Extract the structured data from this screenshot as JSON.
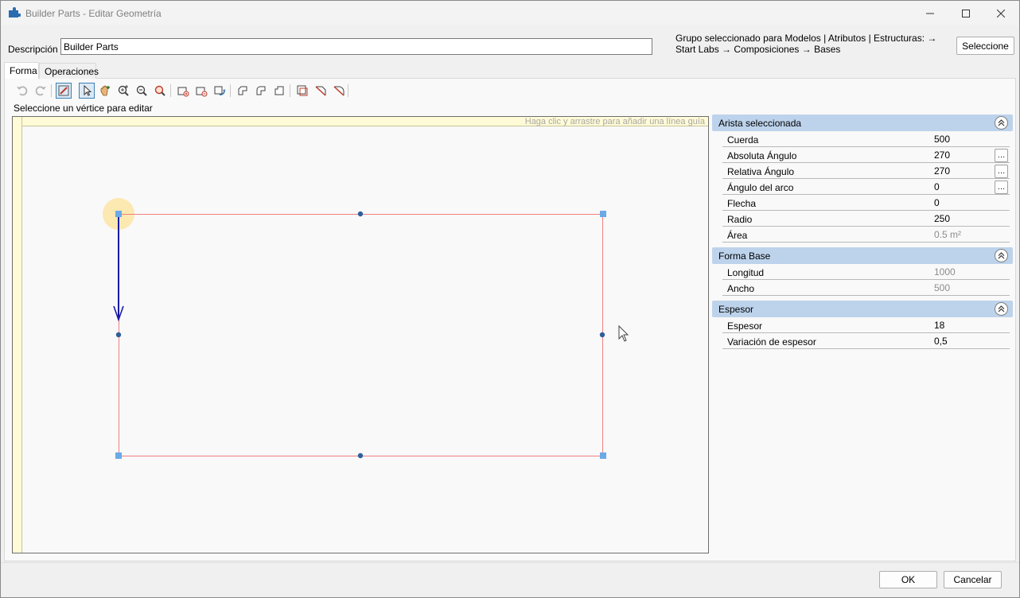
{
  "window": {
    "title": "Builder Parts - Editar Geometría"
  },
  "description": {
    "label": "Descripción",
    "value": "Builder Parts"
  },
  "group": {
    "text": "Grupo seleccionado para Modelos | Atributos | Estructuras:  → Start Labs → Composiciones → Bases",
    "select_label": "Seleccione"
  },
  "tabs": [
    {
      "label": "Forma",
      "active": true
    },
    {
      "label": "Operaciones",
      "active": false
    }
  ],
  "toolbar": {
    "icons": [
      "undo-icon",
      "redo-icon",
      "edit-vertex-icon",
      "select-pointer-icon",
      "pan-hand-icon",
      "zoom-in-icon",
      "zoom-out-icon",
      "zoom-fit-icon",
      "add-shape-icon",
      "remove-shape-icon",
      "rotate-shape-icon",
      "chamfer-corner-icon",
      "round-corner-icon",
      "notch-corner-icon",
      "offset-corner-icon",
      "bevel-edge-icon",
      "arc-edge-icon"
    ]
  },
  "hint": "Seleccione un vértice para editar",
  "canvas": {
    "ruler_hint": "Haga clic y arrastre para añadir una línea guía"
  },
  "properties": {
    "selected_edge": {
      "title": "Arista seleccionada",
      "rows": [
        {
          "label": "Cuerda",
          "value": "500"
        },
        {
          "label": "Absoluta Ángulo",
          "value": "270"
        },
        {
          "label": "Relativa Ángulo",
          "value": "270"
        },
        {
          "label": "Ángulo del arco",
          "value": "0"
        },
        {
          "label": "Flecha",
          "value": "0"
        },
        {
          "label": "Radio",
          "value": "250"
        },
        {
          "label": "Área",
          "value": "0.5 m²"
        }
      ]
    },
    "base_shape": {
      "title": "Forma Base",
      "rows": [
        {
          "label": "Longitud",
          "value": "1000"
        },
        {
          "label": "Ancho",
          "value": "500"
        }
      ]
    },
    "thickness": {
      "title": "Espesor",
      "rows": [
        {
          "label": "Espesor",
          "value": "18"
        },
        {
          "label": "Variación de espesor",
          "value": "0,5"
        }
      ]
    }
  },
  "buttons": {
    "ok": "OK",
    "cancel": "Cancelar"
  },
  "colors": {
    "shape_outline": "#f08080",
    "handle": "#6aaae6",
    "midpoint": "#2f5f9a",
    "direction_arrow": "#1a1aa6",
    "section_header": "#bdd3ec",
    "ruler": "#fffbd6"
  }
}
